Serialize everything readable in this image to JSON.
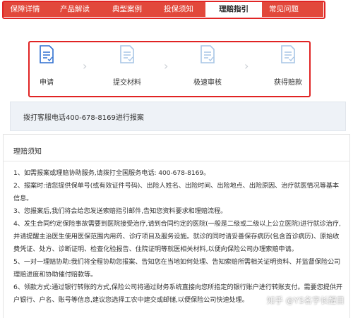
{
  "tabs": [
    {
      "label": "保障详情",
      "active": false
    },
    {
      "label": "产品解读",
      "active": false
    },
    {
      "label": "典型案例",
      "active": false
    },
    {
      "label": "投保须知",
      "active": false
    },
    {
      "label": "理赔指引",
      "active": true
    },
    {
      "label": "常见问题",
      "active": false
    }
  ],
  "steps": [
    {
      "label": "申请",
      "icon": "document-icon",
      "active": true
    },
    {
      "label": "提交材料",
      "icon": "document-icon",
      "active": false
    },
    {
      "label": "极速审核",
      "icon": "document-icon",
      "active": false
    },
    {
      "label": "获得赔款",
      "icon": "document-icon",
      "active": false
    }
  ],
  "phone_notice": "拨打客服电话400-678-8169进行报案",
  "notice": {
    "title": "理赔须知",
    "items": [
      "1、如需报案或理赔协助服务,请拨打全国服务电话: 400-678-8169。",
      "2、报案时:请您提供保单号(或有效证件号码)、出险人姓名、出险时间、出险地点、出险原因、治疗就医情况等基本信息。",
      "3、您报案后,我们将会给您发送索赔指引邮件,告知您资料要求和理赔流程。",
      "4、发生合同约定保险事故需要到医院接受治疗,请到合同约定的医院(一般是二级或二级以上公立医院)进行就诊治疗,并请提醒主治医生使用医保范围内用药、诊疗项目及服务设施。就诊的同时请妥善保存病历(包含首诊病历)、原始收费凭证、处方、诊断证明、检查化验报告、住院证明等就医相关材料,以便向保险公司办理索赔申请。",
      "5、一对一理赔协助:我们将全程协助您报案、告知您在当地如何处理、告知索赔所需相关证明资料、并监督保险公司理赔进度和协助催付赔款等。",
      "6、领款方式:通过银行转账的方式,保险公司将通过财务系统直接向您所指定的银行账户进行转账支付。需要您提供开户银行、户名、账号等信息,建议您选择工农中建交或邮储,以便保险公司快速处理。"
    ]
  },
  "watermark": "知乎 @YS名字长醒目",
  "colors": {
    "tab_bar": "#e2483b",
    "highlight": "#e02424",
    "step_active": "#2f6fd0",
    "step_inactive": "#a9c6e6",
    "phone_box_bg": "#eef2f7"
  }
}
